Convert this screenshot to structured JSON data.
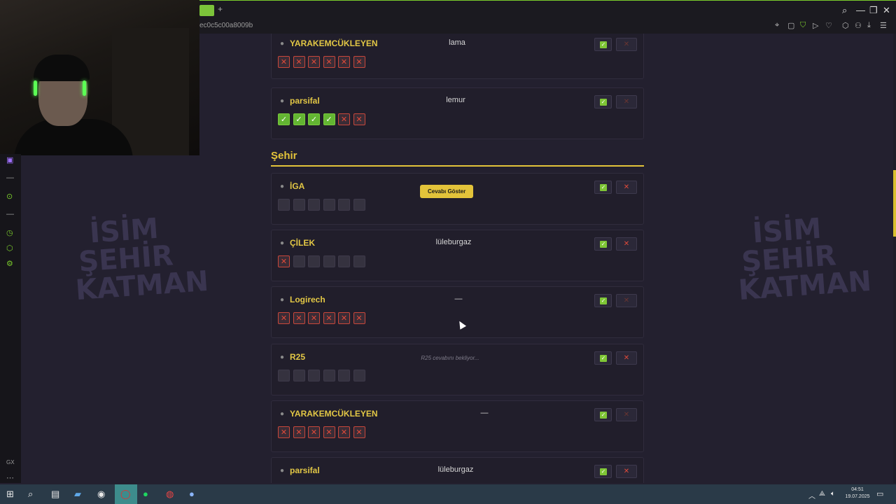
{
  "browser": {
    "url_fragment": "ec0c5c00a8009b",
    "tab_plus": "+",
    "window_controls": {
      "search": "⌕",
      "minimize": "—",
      "restore": "❐",
      "close": "✕"
    }
  },
  "watermark": {
    "lines": [
      "İSİM",
      "ŞEHİR",
      "KATMAN"
    ]
  },
  "section": {
    "title": "Şehir"
  },
  "reveal_label": "Cevabı Göster",
  "cards_top": [
    {
      "name": "YARAKEMCÜKLEYEN",
      "answer": "lama",
      "marks": [
        "x",
        "x",
        "x",
        "x",
        "x",
        "x"
      ],
      "reject_dim": true
    },
    {
      "name": "parsifal",
      "answer": "lemur",
      "marks": [
        "c",
        "c",
        "c",
        "c",
        "x",
        "x"
      ],
      "reject_dim": true
    }
  ],
  "cards_city": [
    {
      "name": "İGA",
      "answer": "",
      "marks": [
        "e",
        "e",
        "e",
        "e",
        "e",
        "e"
      ],
      "reject_dim": false,
      "reveal": true
    },
    {
      "name": "ÇİLEK",
      "answer": "lüleburgaz",
      "marks": [
        "x",
        "e",
        "e",
        "e",
        "e",
        "e"
      ],
      "reject_dim": false
    },
    {
      "name": "Logirech",
      "answer": "—",
      "marks": [
        "x",
        "x",
        "x",
        "x",
        "x",
        "x"
      ],
      "reject_dim": true
    },
    {
      "name": "R25",
      "answer": "R25 cevabını bekliyor...",
      "marks": [
        "e",
        "e",
        "e",
        "e",
        "e",
        "e"
      ],
      "reject_dim": false,
      "waiting": true
    },
    {
      "name": "YARAKEMCÜKLEYEN",
      "answer": "—",
      "marks": [
        "x",
        "x",
        "x",
        "x",
        "x",
        "x"
      ],
      "reject_dim": true
    },
    {
      "name": "parsifal",
      "answer": "lüleburgaz",
      "marks": [
        "e",
        "e",
        "e",
        "e",
        "e",
        "e"
      ],
      "reject_dim": false
    }
  ],
  "taskbar": {
    "time": "04:51",
    "date": "19.07.2025"
  },
  "colors": {
    "accent": "#e3c33a",
    "ok": "#7fc636",
    "reject": "#e04a3a",
    "bg": "#23202f"
  }
}
